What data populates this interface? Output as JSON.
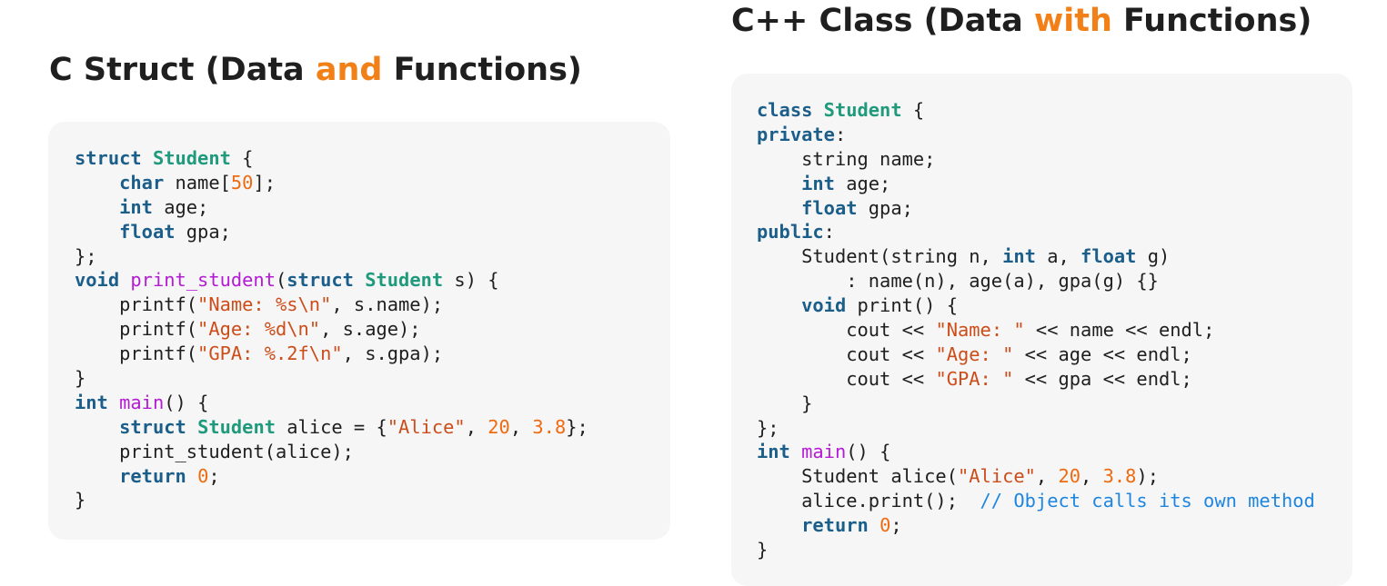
{
  "left_heading": {
    "before": "C Struct (Data ",
    "accent": "and",
    "after": " Functions)"
  },
  "right_heading": {
    "before": "C++ Class (Data ",
    "accent": "with",
    "after": " Functions)"
  },
  "left_code": [
    [
      [
        "kw",
        "struct"
      ],
      [
        "sp",
        " "
      ],
      [
        "ty",
        "Student"
      ],
      [
        "pl",
        " {"
      ]
    ],
    [
      [
        "sp",
        "    "
      ],
      [
        "kw",
        "char"
      ],
      [
        "pl",
        " name["
      ],
      [
        "num",
        "50"
      ],
      [
        "pl",
        "];"
      ]
    ],
    [
      [
        "sp",
        "    "
      ],
      [
        "kw",
        "int"
      ],
      [
        "pl",
        " age;"
      ]
    ],
    [
      [
        "sp",
        "    "
      ],
      [
        "kw",
        "float"
      ],
      [
        "pl",
        " gpa;"
      ]
    ],
    [
      [
        "pl",
        "};"
      ]
    ],
    [
      [
        "kw",
        "void"
      ],
      [
        "sp",
        " "
      ],
      [
        "fn",
        "print_student"
      ],
      [
        "pl",
        "("
      ],
      [
        "kw",
        "struct"
      ],
      [
        "sp",
        " "
      ],
      [
        "ty",
        "Student"
      ],
      [
        "pl",
        " s) {"
      ]
    ],
    [
      [
        "sp",
        "    "
      ],
      [
        "pl",
        "printf("
      ],
      [
        "str",
        "\"Name: %s\\n\""
      ],
      [
        "pl",
        ", s.name);"
      ]
    ],
    [
      [
        "sp",
        "    "
      ],
      [
        "pl",
        "printf("
      ],
      [
        "str",
        "\"Age: %d\\n\""
      ],
      [
        "pl",
        ", s.age);"
      ]
    ],
    [
      [
        "sp",
        "    "
      ],
      [
        "pl",
        "printf("
      ],
      [
        "str",
        "\"GPA: %.2f\\n\""
      ],
      [
        "pl",
        ", s.gpa);"
      ]
    ],
    [
      [
        "pl",
        "}"
      ]
    ],
    [
      [
        "kw",
        "int"
      ],
      [
        "sp",
        " "
      ],
      [
        "fn",
        "main"
      ],
      [
        "pl",
        "() {"
      ]
    ],
    [
      [
        "sp",
        "    "
      ],
      [
        "kw",
        "struct"
      ],
      [
        "sp",
        " "
      ],
      [
        "ty",
        "Student"
      ],
      [
        "pl",
        " alice = {"
      ],
      [
        "str",
        "\"Alice\""
      ],
      [
        "pl",
        ", "
      ],
      [
        "num",
        "20"
      ],
      [
        "pl",
        ", "
      ],
      [
        "num",
        "3.8"
      ],
      [
        "pl",
        "};"
      ]
    ],
    [
      [
        "sp",
        "    "
      ],
      [
        "pl",
        "print_student(alice);"
      ]
    ],
    [
      [
        "sp",
        "    "
      ],
      [
        "kw",
        "return"
      ],
      [
        "sp",
        " "
      ],
      [
        "num",
        "0"
      ],
      [
        "pl",
        ";"
      ]
    ],
    [
      [
        "pl",
        "}"
      ]
    ]
  ],
  "right_code": [
    [
      [
        "kw",
        "class"
      ],
      [
        "sp",
        " "
      ],
      [
        "ty",
        "Student"
      ],
      [
        "pl",
        " {"
      ]
    ],
    [
      [
        "kw",
        "private"
      ],
      [
        "pl",
        ":"
      ]
    ],
    [
      [
        "sp",
        "    "
      ],
      [
        "pl",
        "string name;"
      ]
    ],
    [
      [
        "sp",
        "    "
      ],
      [
        "kw",
        "int"
      ],
      [
        "pl",
        " age;"
      ]
    ],
    [
      [
        "sp",
        "    "
      ],
      [
        "kw",
        "float"
      ],
      [
        "pl",
        " gpa;"
      ]
    ],
    [
      [
        "kw",
        "public"
      ],
      [
        "pl",
        ":"
      ]
    ],
    [
      [
        "sp",
        "    "
      ],
      [
        "pl",
        "Student(string n, "
      ],
      [
        "kw",
        "int"
      ],
      [
        "pl",
        " a, "
      ],
      [
        "kw",
        "float"
      ],
      [
        "pl",
        " g)"
      ]
    ],
    [
      [
        "sp",
        "        "
      ],
      [
        "pl",
        ": name(n), age(a), gpa(g) {}"
      ]
    ],
    [
      [
        "sp",
        "    "
      ],
      [
        "kw",
        "void"
      ],
      [
        "pl",
        " print() {"
      ]
    ],
    [
      [
        "sp",
        "        "
      ],
      [
        "pl",
        "cout << "
      ],
      [
        "str",
        "\"Name: \""
      ],
      [
        "pl",
        " << name << endl;"
      ]
    ],
    [
      [
        "sp",
        "        "
      ],
      [
        "pl",
        "cout << "
      ],
      [
        "str",
        "\"Age: \""
      ],
      [
        "pl",
        " << age << endl;"
      ]
    ],
    [
      [
        "sp",
        "        "
      ],
      [
        "pl",
        "cout << "
      ],
      [
        "str",
        "\"GPA: \""
      ],
      [
        "pl",
        " << gpa << endl;"
      ]
    ],
    [
      [
        "sp",
        "    "
      ],
      [
        "pl",
        "}"
      ]
    ],
    [
      [
        "pl",
        "};"
      ]
    ],
    [
      [
        "kw",
        "int"
      ],
      [
        "sp",
        " "
      ],
      [
        "fn",
        "main"
      ],
      [
        "pl",
        "() {"
      ]
    ],
    [
      [
        "sp",
        "    "
      ],
      [
        "pl",
        "Student alice("
      ],
      [
        "str",
        "\"Alice\""
      ],
      [
        "pl",
        ", "
      ],
      [
        "num",
        "20"
      ],
      [
        "pl",
        ", "
      ],
      [
        "num",
        "3.8"
      ],
      [
        "pl",
        ");"
      ]
    ],
    [
      [
        "sp",
        "    "
      ],
      [
        "pl",
        "alice.print();  "
      ],
      [
        "cm",
        "// Object calls its own method"
      ]
    ],
    [
      [
        "sp",
        "    "
      ],
      [
        "kw",
        "return"
      ],
      [
        "sp",
        " "
      ],
      [
        "num",
        "0"
      ],
      [
        "pl",
        ";"
      ]
    ],
    [
      [
        "pl",
        "}"
      ]
    ]
  ],
  "colors": {
    "accent": "#f28019",
    "keyword": "#1b5e8a",
    "type": "#1f9a7c",
    "function": "#b41bd4",
    "string": "#cc4d19",
    "number": "#f06a0f",
    "comment": "#1e86e0",
    "panel_bg": "#f6f6f6"
  }
}
